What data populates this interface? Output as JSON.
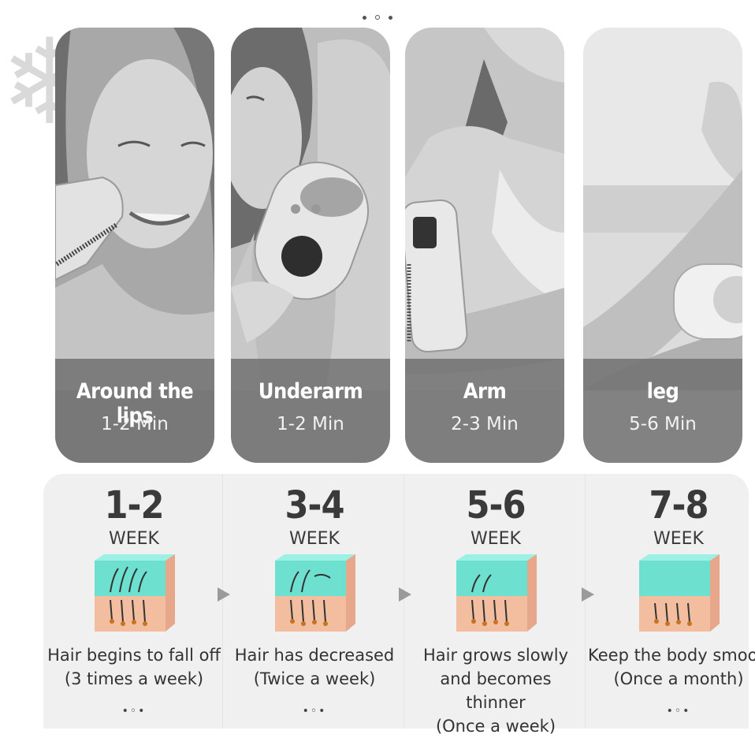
{
  "body_areas": [
    {
      "name": "Around the lips",
      "duration": "1-2 Min"
    },
    {
      "name": "Underarm",
      "duration": "1-2 Min"
    },
    {
      "name": "Arm",
      "duration": "2-3 Min"
    },
    {
      "name": "leg",
      "duration": "5-6 Min"
    }
  ],
  "stages": [
    {
      "range": "1-2",
      "unit": "WEEK",
      "description": "Hair begins to fall off",
      "frequency": "(3 times a week)",
      "more": "•◦•"
    },
    {
      "range": "3-4",
      "unit": "WEEK",
      "description": "Hair has decreased",
      "frequency": "(Twice a week)",
      "more": "•◦•"
    },
    {
      "range": "5-6",
      "unit": "WEEK",
      "description": "Hair grows slowly and becomes thinner",
      "frequency": "(Once a week)",
      "more": ""
    },
    {
      "range": "7-8",
      "unit": "WEEK",
      "description": "Keep the body smooth",
      "frequency": "(Once a month)",
      "more": "•◦•"
    }
  ],
  "colors": {
    "panel": "#f0f0f0",
    "skin_top": "#6ee0d0",
    "skin_bottom": "#f3bda0",
    "accent_text": "#3a3a3a"
  },
  "icons": [
    "snowflake-icon",
    "arrow-right-icon",
    "carousel-dots-icon"
  ]
}
